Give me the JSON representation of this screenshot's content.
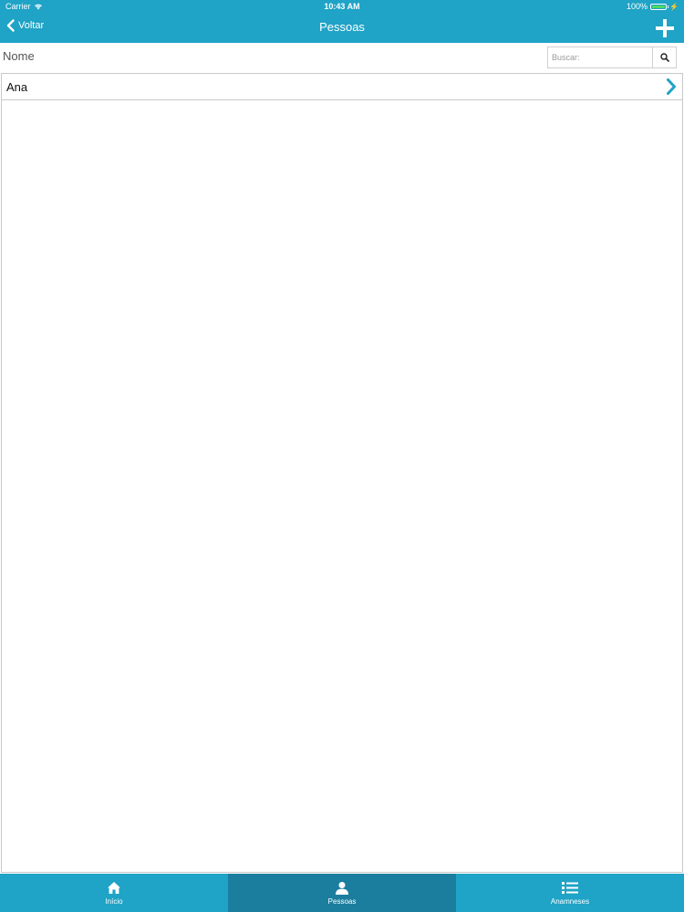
{
  "status": {
    "carrier": "Carrier",
    "time": "10:43 AM",
    "battery": "100%"
  },
  "nav": {
    "back_label": "Voltar",
    "title": "Pessoas"
  },
  "list_header": {
    "column_label": "Nome",
    "search_placeholder": "Buscar:"
  },
  "people": [
    {
      "name": "Ana"
    }
  ],
  "tabs": [
    {
      "label": "Início",
      "icon": "home-icon"
    },
    {
      "label": "Pessoas",
      "icon": "person-icon",
      "active": true
    },
    {
      "label": "Anamneses",
      "icon": "list-icon"
    }
  ],
  "colors": {
    "primary": "#1fa3c6",
    "active_tab": "#1b7e9f",
    "chevron": "#1fa3c6",
    "battery": "#4cd964"
  }
}
